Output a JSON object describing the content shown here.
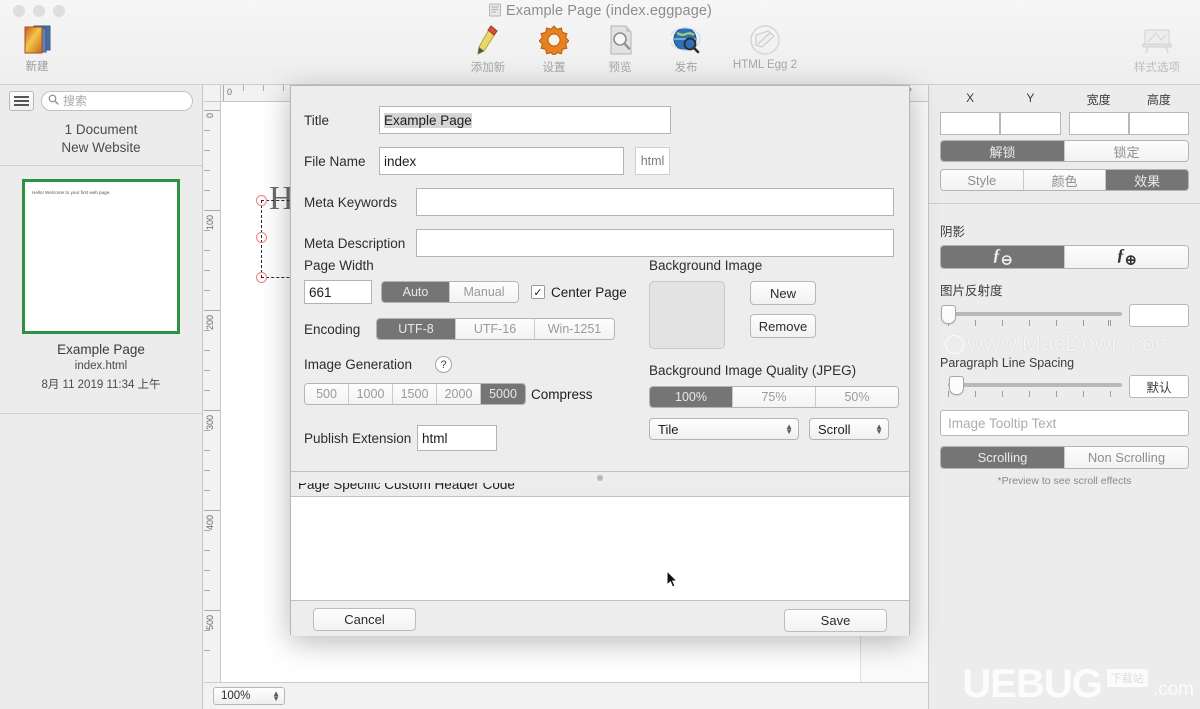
{
  "window": {
    "title": "Example Page (index.eggpage)",
    "doc_icon": "page-icon"
  },
  "toolbar": {
    "new_label": "新建",
    "items": [
      {
        "label": "添加新",
        "icon": "pencil-icon"
      },
      {
        "label": "设置",
        "icon": "gear-icon"
      },
      {
        "label": "预览",
        "icon": "preview-magnifier-icon"
      },
      {
        "label": "发布",
        "icon": "globe-publish-icon"
      },
      {
        "label": "HTML Egg 2",
        "icon": "app-icon"
      }
    ],
    "style_options_label": "样式选项"
  },
  "sidebar": {
    "search_placeholder": "搜索",
    "doc_count": "1 Document",
    "site_name": "New Website",
    "thumb_text": "Hello!  Welcome to your first web page.",
    "page_name": "Example Page",
    "page_file": "index.html",
    "page_date": "8月 11 2019 11:34 上午"
  },
  "canvas": {
    "h_ruler_labels": [
      "0",
      "7"
    ],
    "v_ruler_labels": [
      "0",
      "100",
      "200",
      "300",
      "400",
      "500"
    ],
    "page_text": "He",
    "zoom_level": "100%"
  },
  "inspector": {
    "coord_headers": [
      "X",
      "Y",
      "宽度",
      "高度"
    ],
    "coord_values": [
      "",
      "",
      "",
      ""
    ],
    "lock_segment": {
      "options": [
        "解锁",
        "锁定"
      ],
      "selected": "解锁"
    },
    "tab_segment": {
      "options": [
        "Style",
        "颜色",
        "效果"
      ],
      "selected": "效果"
    },
    "shadow_label": "阴影",
    "shadow_segment": {
      "options": [
        "fx-minus",
        "fx-plus"
      ],
      "selected": "fx-minus"
    },
    "reflection_label": "图片反射度",
    "reflection_value": "",
    "line_spacing_label": "Paragraph Line Spacing",
    "line_spacing_default": "默认",
    "tooltip_placeholder": "Image Tooltip Text",
    "scroll_segment": {
      "options": [
        "Scrolling",
        "Non Scrolling"
      ],
      "selected": "Scrolling"
    },
    "scroll_note": "*Preview to see scroll effects"
  },
  "dialog": {
    "title_label": "Title",
    "title_value": "Example Page",
    "filename_label": "File Name",
    "filename_value": "index",
    "filename_ext": "html",
    "meta_keywords_label": "Meta Keywords",
    "meta_keywords_value": "",
    "meta_description_label": "Meta Description",
    "meta_description_value": "",
    "page_width_label": "Page Width",
    "page_width_value": "661",
    "width_mode": {
      "options": [
        "Auto",
        "Manual"
      ],
      "selected": "Auto"
    },
    "center_page_label": "Center Page",
    "center_page_checked": true,
    "encoding_label": "Encoding",
    "encoding": {
      "options": [
        "UTF-8",
        "UTF-16",
        "Win-1251"
      ],
      "selected": "UTF-8"
    },
    "image_generation_label": "Image Generation",
    "help_glyph": "?",
    "image_sizes": {
      "options": [
        "500",
        "1000",
        "1500",
        "2000",
        "5000"
      ],
      "selected": "5000"
    },
    "compress_label": "Compress",
    "publish_extension_label": "Publish Extension",
    "publish_extension_value": "html",
    "background_image_label": "Background Image",
    "bg_new_label": "New",
    "bg_remove_label": "Remove",
    "bg_quality_label": "Background Image Quality (JPEG)",
    "bg_quality": {
      "options": [
        "100%",
        "75%",
        "50%"
      ],
      "selected": "100%"
    },
    "tile_popup_value": "Tile",
    "scroll_popup_value": "Scroll",
    "custom_header_label": "Page Specific Custom Header Code",
    "custom_header_value": "",
    "cancel_label": "Cancel",
    "save_label": "Save"
  },
  "watermarks": {
    "macdown": "www.MacDown.com",
    "ubug_main": "UEBUG",
    "ubug_domain": ".com",
    "ubug_cn": "下载站"
  },
  "colors": {
    "accent_selected": "#757575",
    "thumb_border": "#2e9141",
    "handle": "#f08080",
    "window_bg": "#f0f0f0"
  }
}
